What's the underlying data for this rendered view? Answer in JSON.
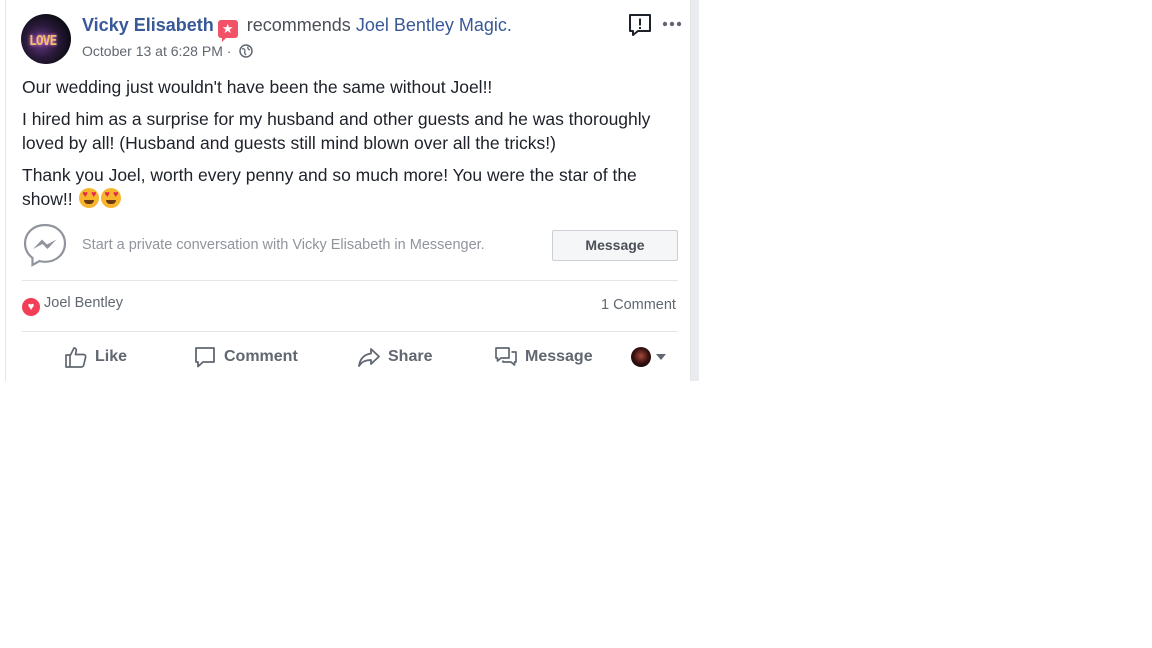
{
  "post": {
    "author": "Vicky Elisabeth",
    "recommends_text": "recommends",
    "page_name": "Joel Bentley Magic.",
    "date": "October 13 at 6:28 PM",
    "date_separator": "·",
    "avatar_text": "LOVE",
    "paragraphs": [
      "Our wedding just wouldn't have been the same without Joel!!",
      "I hired him as a surprise for my husband and other guests and he was thoroughly loved by all! (Husband and guests still mind blown over all the tricks!)",
      "Thank you Joel, worth every penny and so much more! You were the star of the show!!"
    ]
  },
  "messenger_promo": {
    "text": "Start a private conversation with Vicky Elisabeth in Messenger.",
    "button_label": "Message"
  },
  "reactions": {
    "reactor": "Joel Bentley",
    "comment_count": "1 Comment"
  },
  "actions": {
    "like": "Like",
    "comment": "Comment",
    "share": "Share",
    "message": "Message"
  },
  "icons": {
    "recommend_badge": "star-badge-icon",
    "privacy": "globe-icon",
    "report": "report-icon",
    "more": "more-icon",
    "messenger": "messenger-icon",
    "reaction": "love-reaction-icon",
    "emoji": "heart-eyes-emoji"
  },
  "colors": {
    "link": "#385898",
    "badge": "#f25268",
    "love": "#f33e58",
    "muted": "#616770"
  }
}
